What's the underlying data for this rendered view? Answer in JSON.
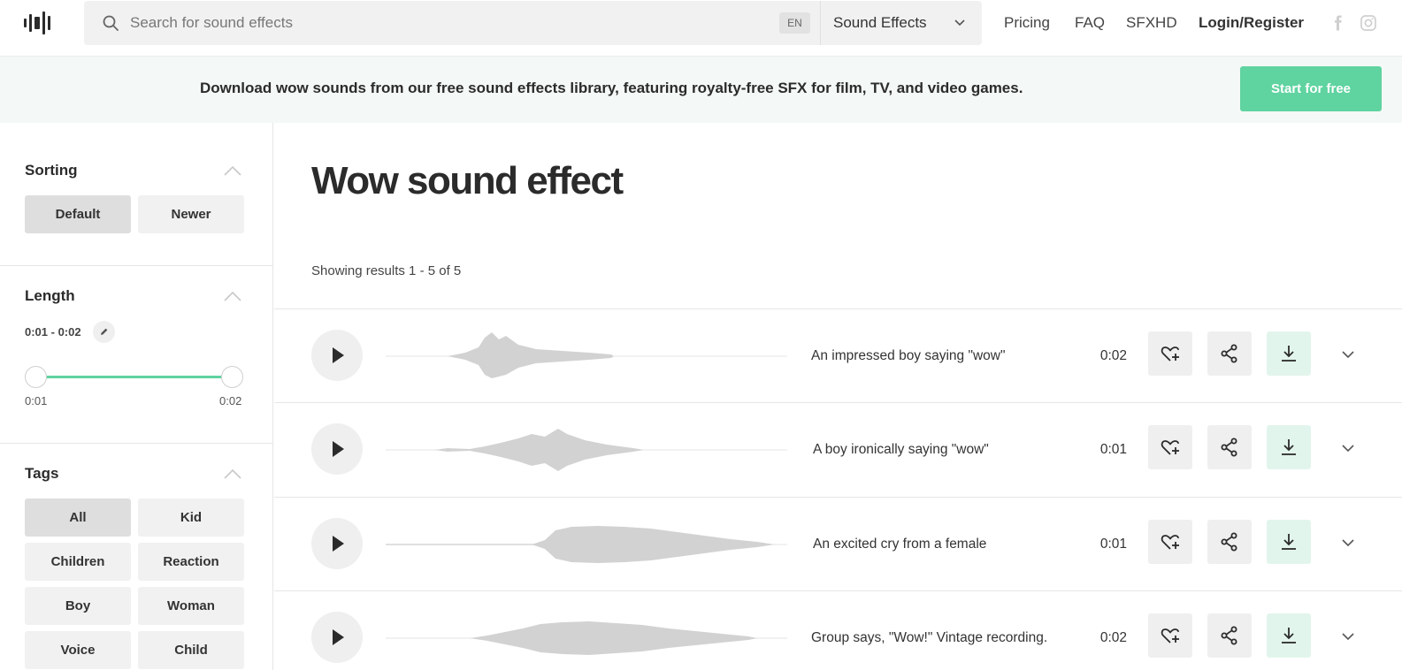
{
  "header": {
    "search_placeholder": "Search for sound effects",
    "language": "EN",
    "category": "Sound Effects",
    "nav": [
      "Pricing",
      "FAQ",
      "SFXHD",
      "Login/Register"
    ],
    "social_icons": [
      "facebook-icon",
      "instagram-icon"
    ]
  },
  "banner": {
    "text": "Download wow sounds from our free sound effects library, featuring royalty-free SFX for film, TV, and video games.",
    "cta": "Start for free"
  },
  "sidebar": {
    "sorting": {
      "title": "Sorting",
      "options": [
        "Default",
        "Newer"
      ],
      "selected": "Default"
    },
    "length": {
      "title": "Length",
      "range_label": "0:01 - 0:02",
      "min_label": "0:01",
      "max_label": "0:02",
      "range_fraction": [
        0,
        1
      ]
    },
    "tags": {
      "title": "Tags",
      "items": [
        "All",
        "Kid",
        "Children",
        "Reaction",
        "Boy",
        "Woman",
        "Voice",
        "Child"
      ],
      "selected": "All"
    }
  },
  "main": {
    "title": "Wow sound effect",
    "results_text": "Showing results 1 - 5 of 5",
    "sounds": [
      {
        "title": "An impressed boy saying \"wow\"",
        "duration": "0:02"
      },
      {
        "title": "A boy ironically saying \"wow\"",
        "duration": "0:01"
      },
      {
        "title": "An excited cry from a female",
        "duration": "0:01"
      },
      {
        "title": "Group says, \"Wow!\" Vintage recording.",
        "duration": "0:02"
      }
    ]
  },
  "colors": {
    "accent": "#5fd3a0",
    "banner_bg": "#f4f8f6",
    "chip_bg": "#f1f1f1",
    "chip_active_bg": "#dedede",
    "waveform": "#d2d2d2",
    "download_bg": "#e2f5ec"
  }
}
